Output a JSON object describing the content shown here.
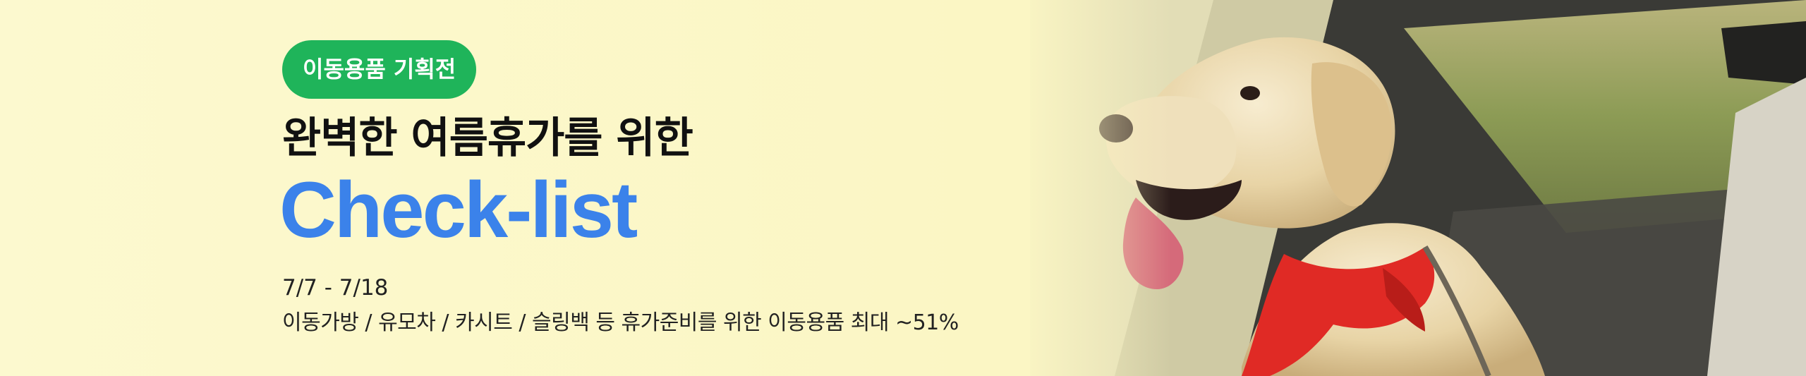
{
  "banner": {
    "badge": "이동용품 기획전",
    "headline": "완벽한 여름휴가를 위한",
    "title_en": "Check-list",
    "date_range": "7/7 - 7/18",
    "description": "이동가방 / 유모차 / 카시트 / 슬링백 등 휴가준비를 위한 이동용품 최대 ~51%"
  },
  "colors": {
    "background": "#fbf7c8",
    "badge_bg": "#1fb45a",
    "title_en": "#3b82ea",
    "headline": "#111111",
    "scarf": "#e02a25"
  },
  "image": {
    "subject": "dog-in-car-photo"
  }
}
